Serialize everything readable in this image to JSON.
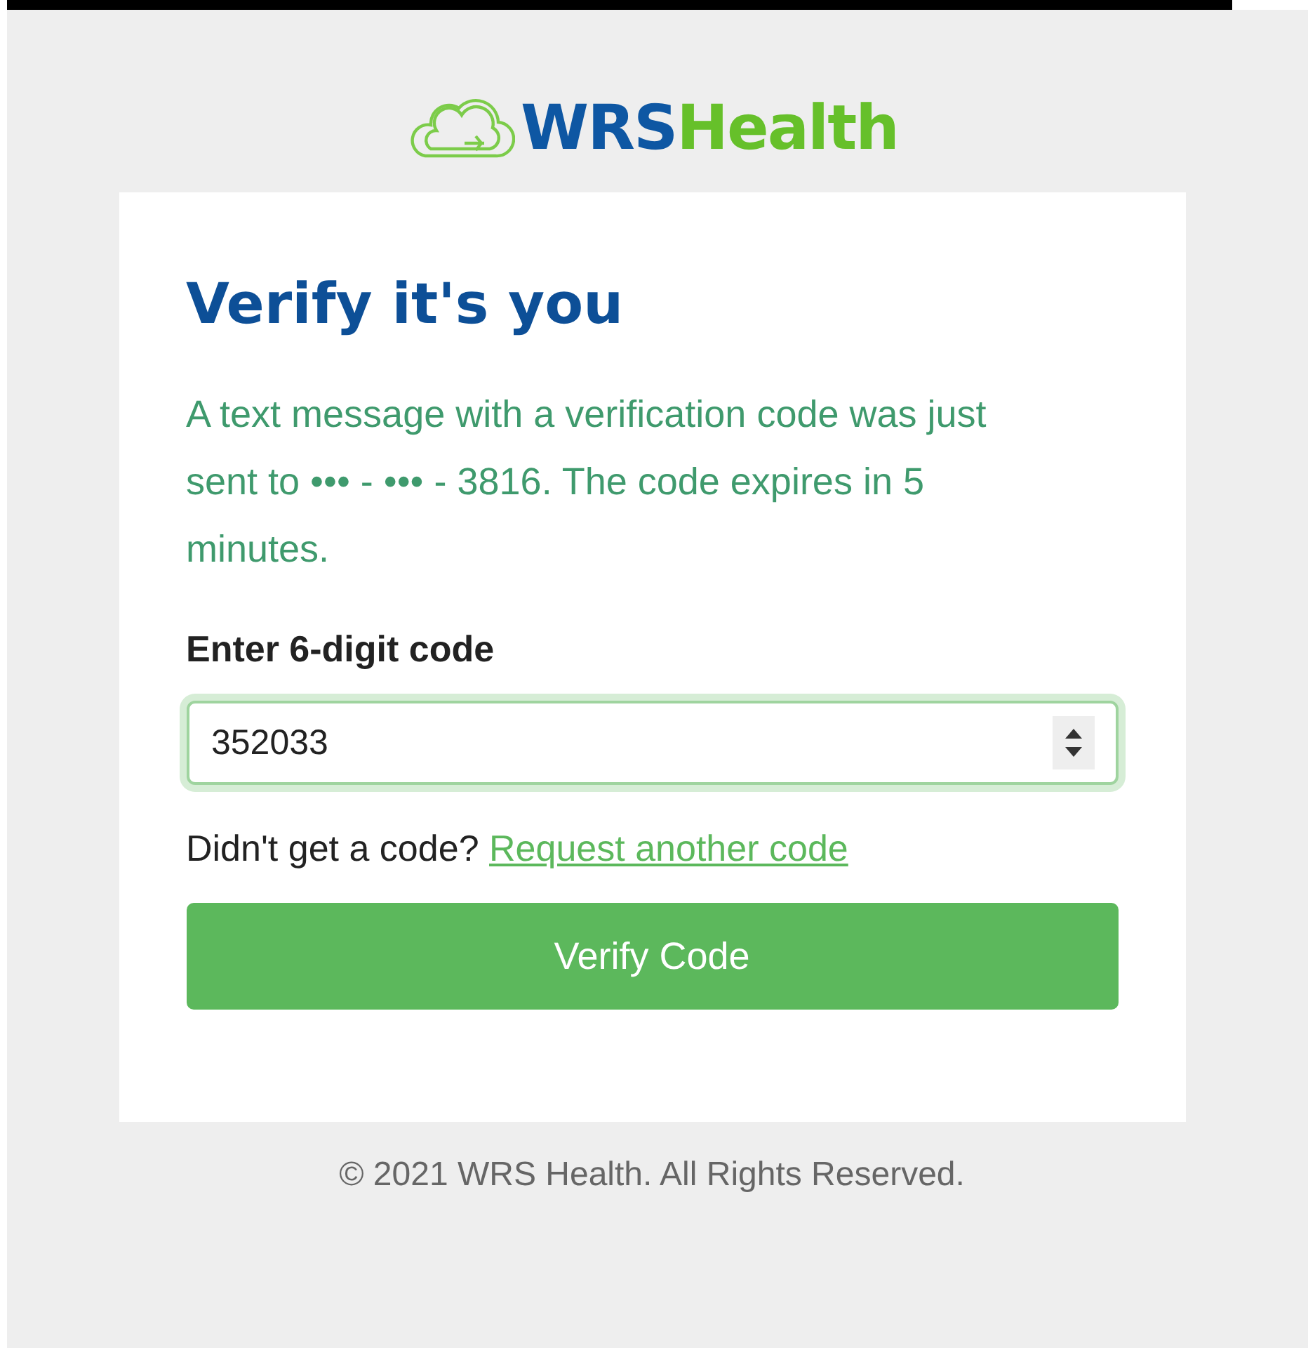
{
  "logo": {
    "brand_primary": "WRS",
    "brand_secondary": "Health"
  },
  "card": {
    "title": "Verify it's you",
    "message": "A text message with a verification code was just sent to ••• - ••• - 3816. The code expires in 5 minutes.",
    "code_field": {
      "label": "Enter 6-digit code",
      "value": "352033",
      "focused": true
    },
    "resend": {
      "prompt": "Didn't get a code?",
      "link": "Request another code"
    },
    "submit_button": "Verify Code"
  },
  "footer": "© 2021 WRS Health. All Rights Reserved."
}
